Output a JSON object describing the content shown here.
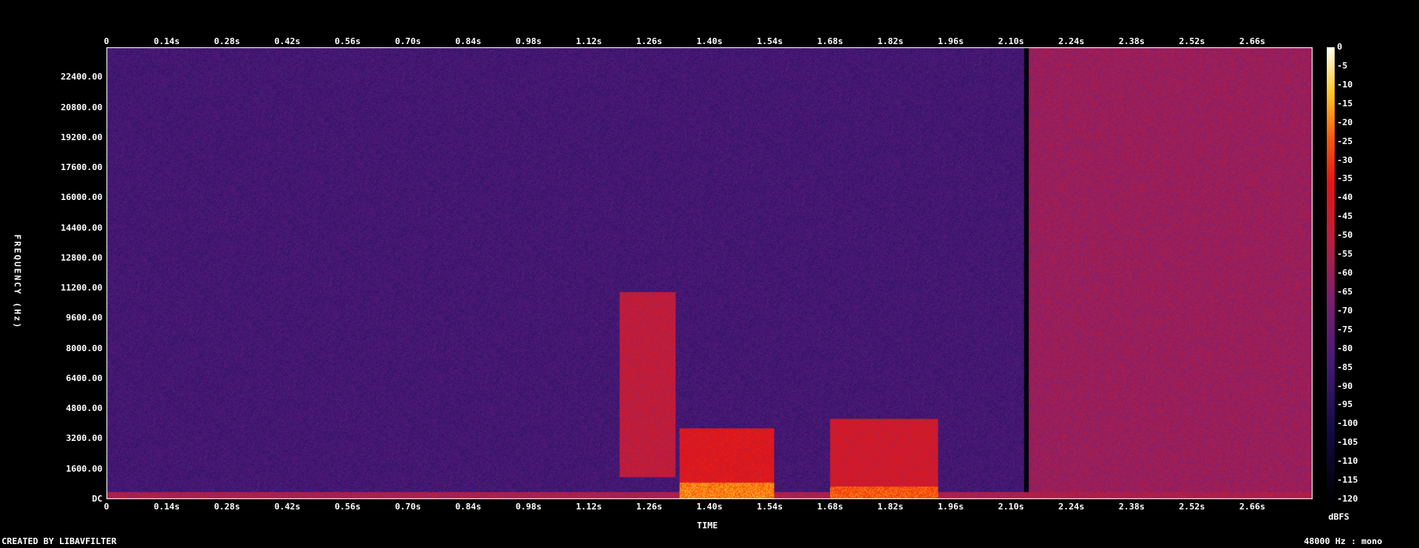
{
  "chart_data": {
    "type": "heatmap",
    "xlabel": "TIME",
    "ylabel": "FREQUENCY (Hz)",
    "x_ticks": [
      "0",
      "0.14s",
      "0.28s",
      "0.42s",
      "0.56s",
      "0.70s",
      "0.84s",
      "0.98s",
      "1.12s",
      "1.26s",
      "1.40s",
      "1.54s",
      "1.68s",
      "1.82s",
      "1.96s",
      "2.10s",
      "2.24s",
      "2.38s",
      "2.52s",
      "2.66s"
    ],
    "x_tick_values": [
      0,
      0.14,
      0.28,
      0.42,
      0.56,
      0.7,
      0.84,
      0.98,
      1.12,
      1.26,
      1.4,
      1.54,
      1.68,
      1.82,
      1.96,
      2.1,
      2.24,
      2.38,
      2.52,
      2.66
    ],
    "x_range": [
      0,
      2.8
    ],
    "y_ticks": [
      "DC",
      "1600.00",
      "3200.00",
      "4800.00",
      "6400.00",
      "8000.00",
      "9600.00",
      "11200.00",
      "12800.00",
      "14400.00",
      "16000.00",
      "17600.00",
      "19200.00",
      "20800.00",
      "22400.00"
    ],
    "y_tick_values": [
      0,
      1600,
      3200,
      4800,
      6400,
      8000,
      9600,
      11200,
      12800,
      14400,
      16000,
      17600,
      19200,
      20800,
      22400
    ],
    "y_range": [
      0,
      24000
    ],
    "colorbar": {
      "label": "dBFS",
      "ticks": [
        "0",
        "-5",
        "-10",
        "-15",
        "-20",
        "-25",
        "-30",
        "-35",
        "-40",
        "-45",
        "-50",
        "-55",
        "-60",
        "-65",
        "-70",
        "-75",
        "-80",
        "-85",
        "-90",
        "-95",
        "-100",
        "-105",
        "-110",
        "-115",
        "-120"
      ],
      "range": [
        -120,
        0
      ]
    },
    "regions": [
      {
        "t": [
          0,
          2.13
        ],
        "f": [
          0,
          24000
        ],
        "level_db": -85
      },
      {
        "t": [
          0,
          2.8
        ],
        "f": [
          0,
          400
        ],
        "level_db": -55
      },
      {
        "t": [
          1.19,
          1.32
        ],
        "f": [
          1200,
          11000
        ],
        "level_db": -50
      },
      {
        "t": [
          1.33,
          1.55
        ],
        "f": [
          0,
          3800
        ],
        "level_db": -40
      },
      {
        "t": [
          1.33,
          1.55
        ],
        "f": [
          0,
          900
        ],
        "level_db": -20
      },
      {
        "t": [
          1.68,
          1.93
        ],
        "f": [
          0,
          4300
        ],
        "level_db": -45
      },
      {
        "t": [
          1.68,
          1.93
        ],
        "f": [
          0,
          700
        ],
        "level_db": -25
      },
      {
        "t": [
          2.14,
          2.8
        ],
        "f": [
          0,
          24000
        ],
        "level_db": -60
      }
    ]
  },
  "footer": {
    "credit": "CREATED BY LIBAVFILTER",
    "info": "48000 Hz : mono"
  },
  "colors": {
    "background": "#000000",
    "frame": "#ffffff"
  }
}
